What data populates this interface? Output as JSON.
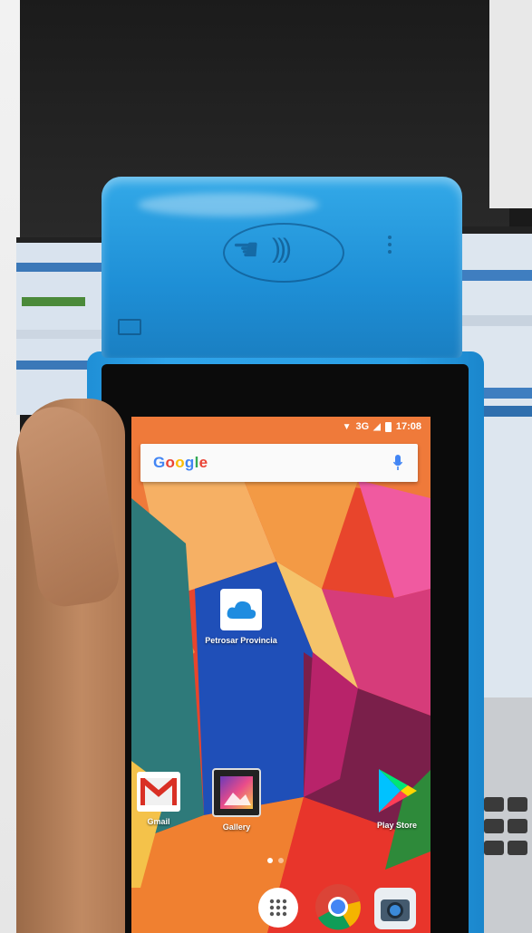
{
  "status_bar": {
    "network": "3G",
    "time": "17:08"
  },
  "search": {
    "logo_letters": [
      "G",
      "o",
      "o",
      "g",
      "l",
      "e"
    ]
  },
  "apps": {
    "cloud": {
      "label": "Petrosar Provincia"
    },
    "gmail": {
      "label": "Gmail"
    },
    "gallery": {
      "label": "Gallery"
    },
    "play_store": {
      "label": "Play Store"
    }
  },
  "dock": {
    "items": [
      "app-drawer",
      "chrome",
      "camera"
    ]
  },
  "colors": {
    "device_blue": "#1e8fd6",
    "google_blue": "#4285F4",
    "google_red": "#EA4335",
    "google_yellow": "#FBBC05",
    "google_green": "#34A853"
  }
}
